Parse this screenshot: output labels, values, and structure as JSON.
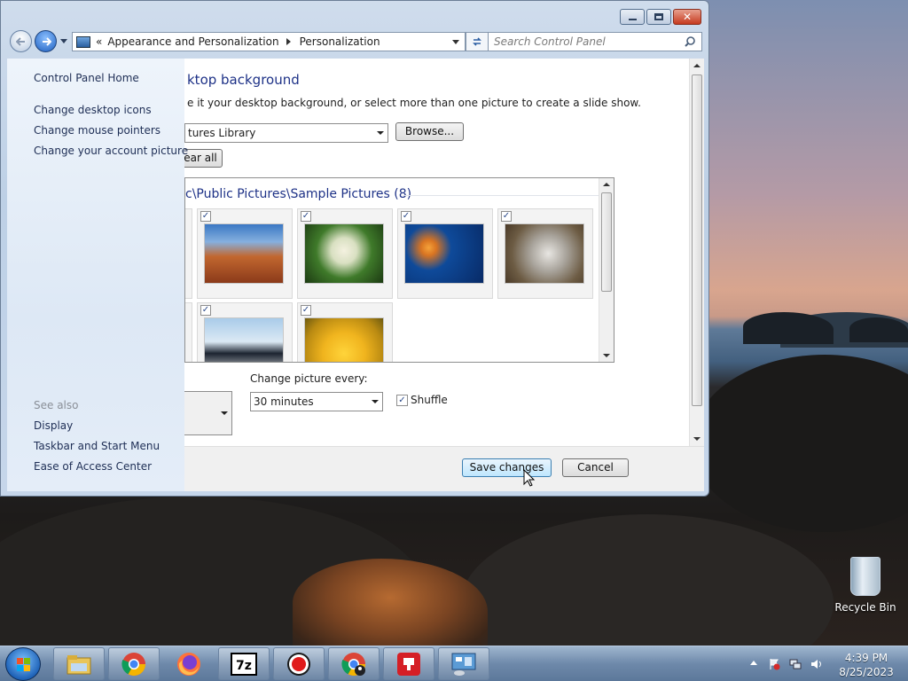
{
  "window": {
    "controls": {
      "minimize": "—",
      "maximize": "□",
      "close": "✕"
    },
    "address": {
      "root_chevron": "«",
      "crumb1": "Appearance and Personalization",
      "crumb2": "Personalization"
    },
    "search": {
      "placeholder": "Search Control Panel"
    }
  },
  "sidebar": {
    "home": "Control Panel Home",
    "links": [
      "Change desktop icons",
      "Change mouse pointers",
      "Change your account picture"
    ],
    "see_also_label": "See also",
    "see_also": [
      "Display",
      "Taskbar and Start Menu",
      "Ease of Access Center"
    ]
  },
  "main": {
    "heading": "ktop background",
    "description": "e it your desktop background, or select more than one picture to create a slide show.",
    "location_value": "tures Library",
    "browse_label": "Browse...",
    "clear_all_label": "ear all",
    "group_title": "c\\Public Pictures\\Sample Pictures (8)",
    "tiles": [
      {
        "name": "desert",
        "checked": true
      },
      {
        "name": "hydrangeas",
        "checked": true
      },
      {
        "name": "jellyfish",
        "checked": true
      },
      {
        "name": "koala",
        "checked": true
      },
      {
        "name": "penguins",
        "checked": true
      },
      {
        "name": "tulips",
        "checked": true
      }
    ],
    "change_every_label": "Change picture every:",
    "change_every_value": "30 minutes",
    "shuffle_label": "Shuffle",
    "shuffle_checked": true
  },
  "footer": {
    "save_label": "Save changes",
    "cancel_label": "Cancel"
  },
  "desktop": {
    "recycle_bin_label": "Recycle Bin"
  },
  "taskbar": {
    "apps": [
      "file-explorer",
      "chrome",
      "firefox",
      "7zip",
      "recorder",
      "chrome-profile",
      "anydesk",
      "control-panel"
    ],
    "time": "4:39 PM",
    "date": "8/25/2023"
  }
}
